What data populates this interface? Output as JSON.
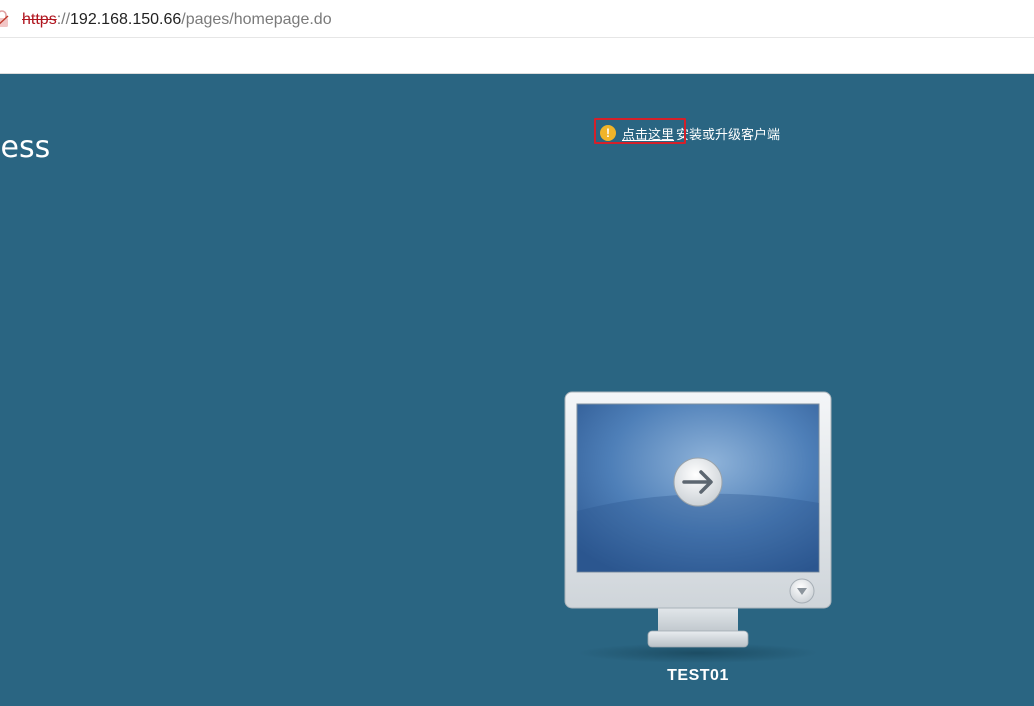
{
  "browser": {
    "url_scheme": "https",
    "url_separator": "://",
    "url_host": "192.168.150.66",
    "url_path": "/pages/homepage.do"
  },
  "page": {
    "title_fragment": "cess"
  },
  "notice": {
    "icon": "warning-icon",
    "link_text": "点击这里",
    "text": "安装或升级客户端",
    "highlight_color": "#d4202a"
  },
  "desktops": [
    {
      "name": "TEST01",
      "icon": "monitor-icon"
    }
  ],
  "colors": {
    "background": "#2a6582",
    "accent_warning": "#f0b429"
  }
}
